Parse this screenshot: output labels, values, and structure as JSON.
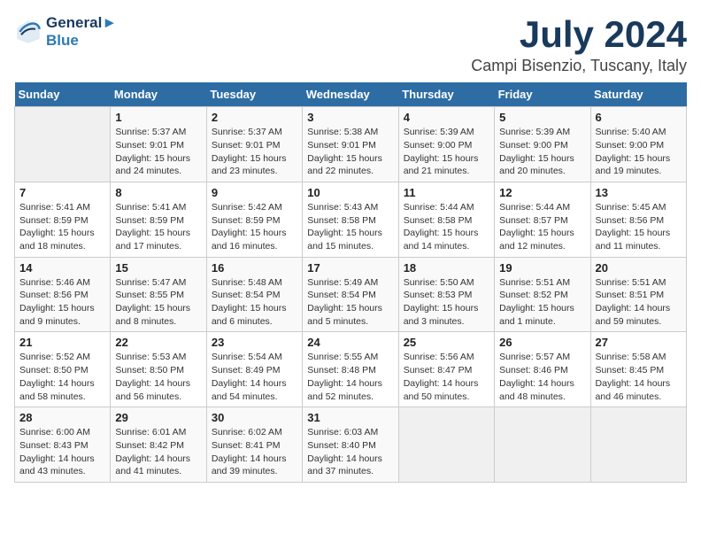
{
  "header": {
    "logo_line1": "General",
    "logo_line2": "Blue",
    "title": "July 2024",
    "subtitle": "Campi Bisenzio, Tuscany, Italy"
  },
  "days_of_week": [
    "Sunday",
    "Monday",
    "Tuesday",
    "Wednesday",
    "Thursday",
    "Friday",
    "Saturday"
  ],
  "weeks": [
    [
      {
        "day": "",
        "info": ""
      },
      {
        "day": "1",
        "info": "Sunrise: 5:37 AM\nSunset: 9:01 PM\nDaylight: 15 hours\nand 24 minutes."
      },
      {
        "day": "2",
        "info": "Sunrise: 5:37 AM\nSunset: 9:01 PM\nDaylight: 15 hours\nand 23 minutes."
      },
      {
        "day": "3",
        "info": "Sunrise: 5:38 AM\nSunset: 9:01 PM\nDaylight: 15 hours\nand 22 minutes."
      },
      {
        "day": "4",
        "info": "Sunrise: 5:39 AM\nSunset: 9:00 PM\nDaylight: 15 hours\nand 21 minutes."
      },
      {
        "day": "5",
        "info": "Sunrise: 5:39 AM\nSunset: 9:00 PM\nDaylight: 15 hours\nand 20 minutes."
      },
      {
        "day": "6",
        "info": "Sunrise: 5:40 AM\nSunset: 9:00 PM\nDaylight: 15 hours\nand 19 minutes."
      }
    ],
    [
      {
        "day": "7",
        "info": "Sunrise: 5:41 AM\nSunset: 8:59 PM\nDaylight: 15 hours\nand 18 minutes."
      },
      {
        "day": "8",
        "info": "Sunrise: 5:41 AM\nSunset: 8:59 PM\nDaylight: 15 hours\nand 17 minutes."
      },
      {
        "day": "9",
        "info": "Sunrise: 5:42 AM\nSunset: 8:59 PM\nDaylight: 15 hours\nand 16 minutes."
      },
      {
        "day": "10",
        "info": "Sunrise: 5:43 AM\nSunset: 8:58 PM\nDaylight: 15 hours\nand 15 minutes."
      },
      {
        "day": "11",
        "info": "Sunrise: 5:44 AM\nSunset: 8:58 PM\nDaylight: 15 hours\nand 14 minutes."
      },
      {
        "day": "12",
        "info": "Sunrise: 5:44 AM\nSunset: 8:57 PM\nDaylight: 15 hours\nand 12 minutes."
      },
      {
        "day": "13",
        "info": "Sunrise: 5:45 AM\nSunset: 8:56 PM\nDaylight: 15 hours\nand 11 minutes."
      }
    ],
    [
      {
        "day": "14",
        "info": "Sunrise: 5:46 AM\nSunset: 8:56 PM\nDaylight: 15 hours\nand 9 minutes."
      },
      {
        "day": "15",
        "info": "Sunrise: 5:47 AM\nSunset: 8:55 PM\nDaylight: 15 hours\nand 8 minutes."
      },
      {
        "day": "16",
        "info": "Sunrise: 5:48 AM\nSunset: 8:54 PM\nDaylight: 15 hours\nand 6 minutes."
      },
      {
        "day": "17",
        "info": "Sunrise: 5:49 AM\nSunset: 8:54 PM\nDaylight: 15 hours\nand 5 minutes."
      },
      {
        "day": "18",
        "info": "Sunrise: 5:50 AM\nSunset: 8:53 PM\nDaylight: 15 hours\nand 3 minutes."
      },
      {
        "day": "19",
        "info": "Sunrise: 5:51 AM\nSunset: 8:52 PM\nDaylight: 15 hours\nand 1 minute."
      },
      {
        "day": "20",
        "info": "Sunrise: 5:51 AM\nSunset: 8:51 PM\nDaylight: 14 hours\nand 59 minutes."
      }
    ],
    [
      {
        "day": "21",
        "info": "Sunrise: 5:52 AM\nSunset: 8:50 PM\nDaylight: 14 hours\nand 58 minutes."
      },
      {
        "day": "22",
        "info": "Sunrise: 5:53 AM\nSunset: 8:50 PM\nDaylight: 14 hours\nand 56 minutes."
      },
      {
        "day": "23",
        "info": "Sunrise: 5:54 AM\nSunset: 8:49 PM\nDaylight: 14 hours\nand 54 minutes."
      },
      {
        "day": "24",
        "info": "Sunrise: 5:55 AM\nSunset: 8:48 PM\nDaylight: 14 hours\nand 52 minutes."
      },
      {
        "day": "25",
        "info": "Sunrise: 5:56 AM\nSunset: 8:47 PM\nDaylight: 14 hours\nand 50 minutes."
      },
      {
        "day": "26",
        "info": "Sunrise: 5:57 AM\nSunset: 8:46 PM\nDaylight: 14 hours\nand 48 minutes."
      },
      {
        "day": "27",
        "info": "Sunrise: 5:58 AM\nSunset: 8:45 PM\nDaylight: 14 hours\nand 46 minutes."
      }
    ],
    [
      {
        "day": "28",
        "info": "Sunrise: 6:00 AM\nSunset: 8:43 PM\nDaylight: 14 hours\nand 43 minutes."
      },
      {
        "day": "29",
        "info": "Sunrise: 6:01 AM\nSunset: 8:42 PM\nDaylight: 14 hours\nand 41 minutes."
      },
      {
        "day": "30",
        "info": "Sunrise: 6:02 AM\nSunset: 8:41 PM\nDaylight: 14 hours\nand 39 minutes."
      },
      {
        "day": "31",
        "info": "Sunrise: 6:03 AM\nSunset: 8:40 PM\nDaylight: 14 hours\nand 37 minutes."
      },
      {
        "day": "",
        "info": ""
      },
      {
        "day": "",
        "info": ""
      },
      {
        "day": "",
        "info": ""
      }
    ]
  ]
}
